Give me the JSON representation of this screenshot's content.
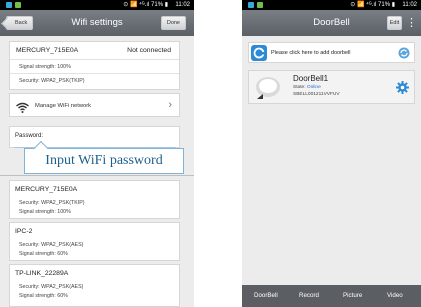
{
  "status_bar": {
    "time_left": "11:02",
    "time_right": "11:02",
    "signal_text": "⊙ 📶 ⁴ᴳ.ıl 71% ▮"
  },
  "wifi_screen": {
    "title": "Wifi settings",
    "back_label": "Back",
    "done_label": "Done",
    "current_network": {
      "ssid": "MERCURY_715E0A",
      "state": "Not connected",
      "signal": "Signal strength:  100%",
      "security": "Security:  WPA2_PSK(TKIP)"
    },
    "manage_label": "Manage WiFi network",
    "password_label": "Password:",
    "tooltip": "Input WiFi password",
    "networks": [
      {
        "ssid": "MERCURY_715E0A",
        "security": "Security:  WPA2_PSK(TKIP)",
        "signal": "Signal strength:  100%"
      },
      {
        "ssid": "IPC-2",
        "security": "Security:  WPA2_PSK(AES)",
        "signal": "Signal strength:  60%"
      },
      {
        "ssid": "TP-LINK_22289A",
        "security": "Security:  WPA2_PSK(AES)",
        "signal": "Signal strength:  60%"
      }
    ]
  },
  "doorbell_screen": {
    "title": "DoorBell",
    "edit_label": "Edit",
    "more_label": "⋮",
    "add_prompt": "Please click here to add doorbell",
    "device": {
      "name": "DoorBell1",
      "state_label": "State:",
      "state_value": "Online",
      "device_id": "SBELL001211VVFUV"
    },
    "tabs": [
      "DoorBell",
      "Record",
      "Picture",
      "Video"
    ]
  },
  "colors": {
    "navbar": "#5b5f66",
    "online": "#1e6fd0",
    "accent_blue": "#2d8bd6"
  }
}
